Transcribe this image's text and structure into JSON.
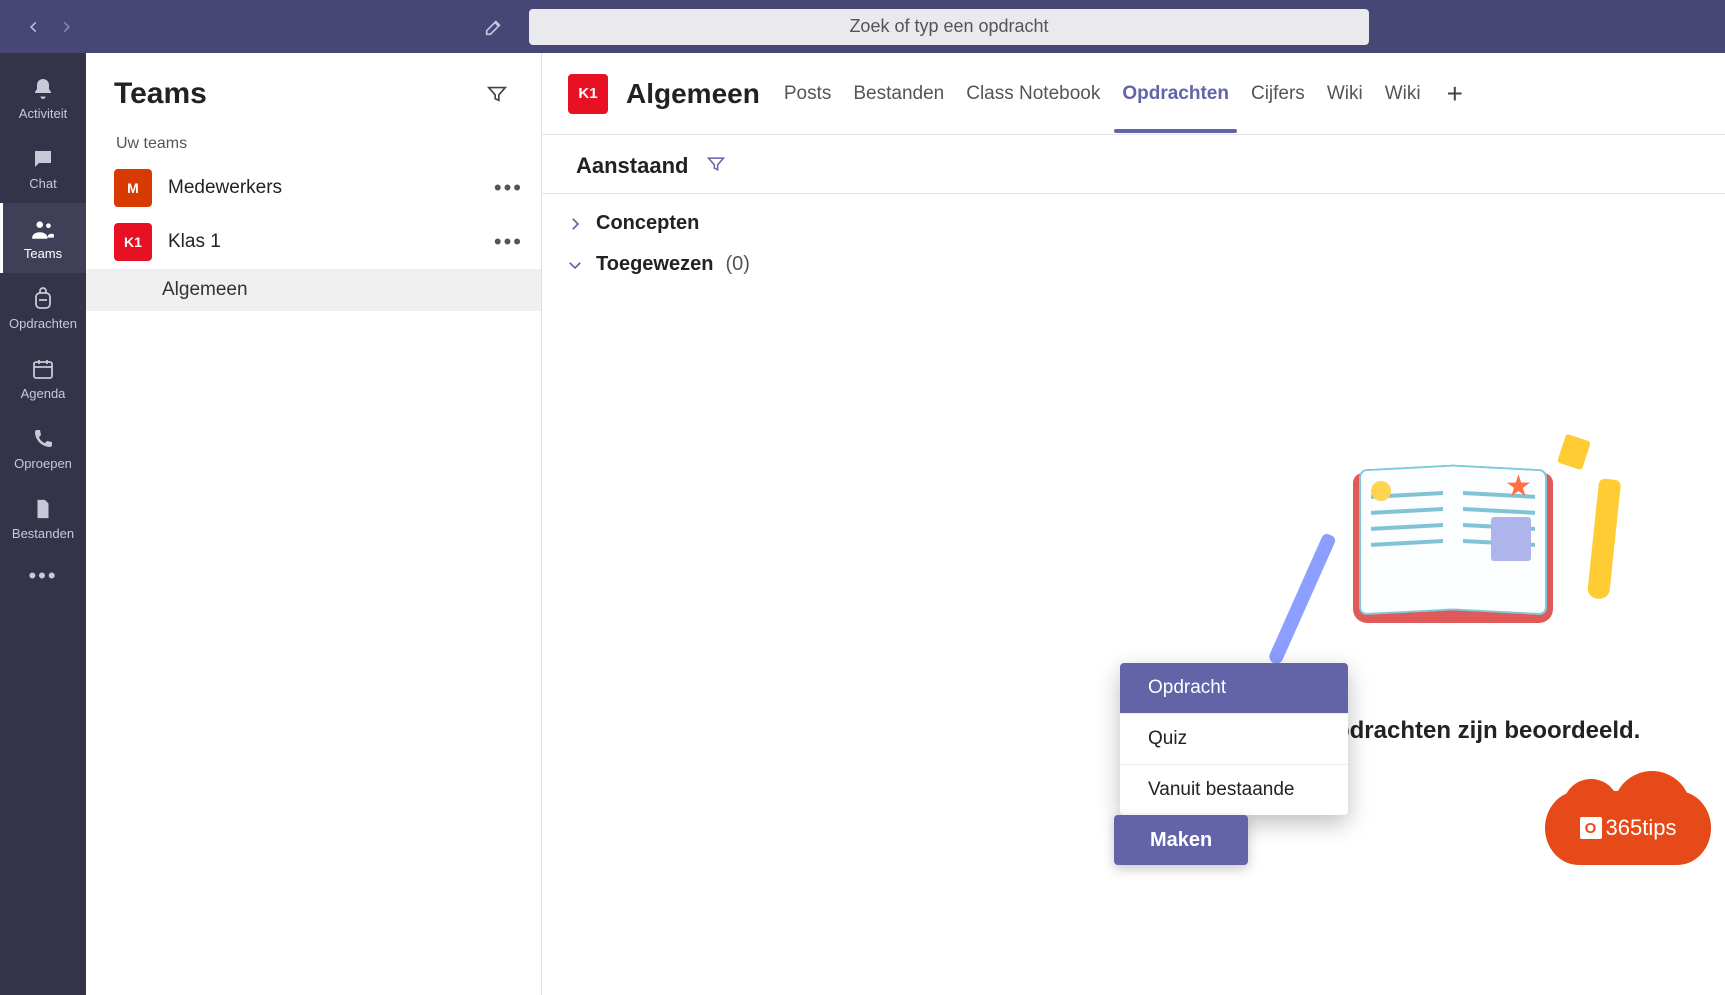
{
  "search": {
    "placeholder": "Zoek of typ een opdracht"
  },
  "rail": {
    "activity": "Activiteit",
    "chat": "Chat",
    "teams": "Teams",
    "assignments": "Opdrachten",
    "calendar": "Agenda",
    "calls": "Oproepen",
    "files": "Bestanden"
  },
  "sidebar": {
    "header": "Teams",
    "section_label": "Uw teams",
    "teams": [
      {
        "initial": "M",
        "name": "Medewerkers",
        "color": "#d83b01"
      },
      {
        "initial": "K1",
        "name": "Klas 1",
        "color": "#e81123"
      }
    ],
    "channel_selected": "Algemeen"
  },
  "channel": {
    "avatar_initial": "K1",
    "title": "Algemeen",
    "tabs": [
      "Posts",
      "Bestanden",
      "Class Notebook",
      "Opdrachten",
      "Cijfers",
      "Wiki",
      "Wiki"
    ],
    "active_tab_index": 3
  },
  "assignments": {
    "toolbar_label": "Aanstaand",
    "categories": [
      {
        "label": "Concepten",
        "expanded": false
      },
      {
        "label": "Toegewezen",
        "count": "(0)",
        "expanded": true
      }
    ],
    "empty_caption": "Alle opdrachten zijn beoordeeld."
  },
  "create": {
    "button_label": "Maken",
    "menu": [
      "Opdracht",
      "Quiz",
      "Vanuit bestaande"
    ],
    "selected_index": 0
  },
  "watermark": {
    "text": "365tips"
  }
}
